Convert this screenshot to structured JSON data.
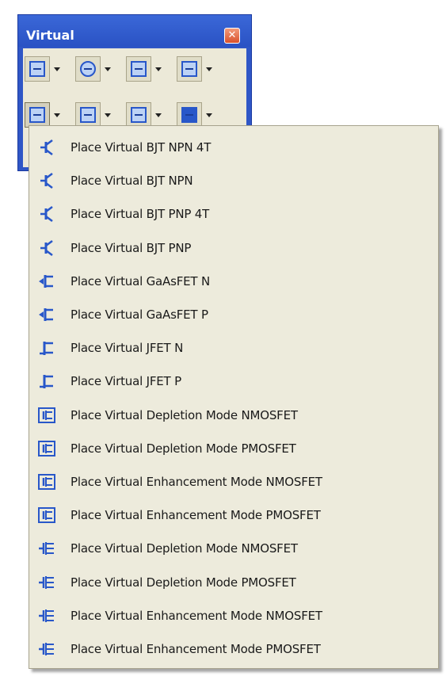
{
  "window": {
    "title": "Virtual",
    "close_glyph": "✕"
  },
  "toolbar": {
    "row1": [
      {
        "icon": "transistor-group-icon"
      },
      {
        "icon": "circle-source-icon"
      },
      {
        "icon": "measurement-icon"
      },
      {
        "icon": "diode-icon"
      }
    ],
    "row2": [
      {
        "icon": "transistor-group-icon",
        "pressed": true
      },
      {
        "icon": "analog-amplifier-icon"
      },
      {
        "icon": "misc-component-icon"
      },
      {
        "icon": "rated-component-icon"
      }
    ]
  },
  "menu": {
    "items": [
      {
        "label": "Place Virtual BJT NPN 4T",
        "icon": "bjt-npn-4t-icon"
      },
      {
        "label": "Place Virtual BJT NPN",
        "icon": "bjt-npn-icon"
      },
      {
        "label": "Place Virtual BJT PNP 4T",
        "icon": "bjt-pnp-4t-icon"
      },
      {
        "label": "Place Virtual BJT PNP",
        "icon": "bjt-pnp-icon"
      },
      {
        "label": "Place Virtual GaAsFET N",
        "icon": "gaasfet-n-icon"
      },
      {
        "label": "Place Virtual GaAsFET P",
        "icon": "gaasfet-p-icon"
      },
      {
        "label": "Place Virtual JFET N",
        "icon": "jfet-n-icon"
      },
      {
        "label": "Place Virtual JFET P",
        "icon": "jfet-p-icon"
      },
      {
        "label": "Place Virtual Depletion Mode NMOSFET",
        "icon": "depletion-nmosfet-icon"
      },
      {
        "label": "Place Virtual Depletion Mode PMOSFET",
        "icon": "depletion-pmosfet-icon"
      },
      {
        "label": "Place Virtual Enhancement Mode NMOSFET",
        "icon": "enhancement-nmosfet-icon"
      },
      {
        "label": "Place Virtual Enhancement Mode PMOSFET",
        "icon": "enhancement-pmosfet-icon"
      },
      {
        "label": "Place Virtual Depletion Mode NMOSFET",
        "icon": "depletion-nmosfet-4t-icon"
      },
      {
        "label": "Place Virtual Depletion Mode PMOSFET",
        "icon": "depletion-pmosfet-4t-icon"
      },
      {
        "label": "Place Virtual Enhancement Mode NMOSFET",
        "icon": "enhancement-nmosfet-4t-icon"
      },
      {
        "label": "Place Virtual Enhancement Mode PMOSFET",
        "icon": "enhancement-pmosfet-4t-icon"
      }
    ]
  },
  "colors": {
    "title_bar": "#2f56c6",
    "menu_bg": "#edebdc",
    "icon_blue": "#2857c9"
  }
}
